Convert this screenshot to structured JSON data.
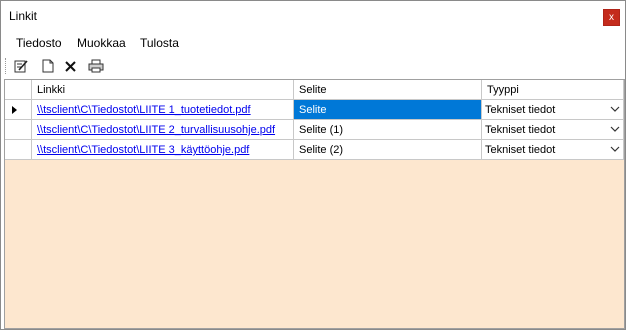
{
  "window": {
    "title": "Linkit",
    "close_label": "x"
  },
  "menu": {
    "items": [
      "Tiedosto",
      "Muokkaa",
      "Tulosta"
    ]
  },
  "toolbar": {
    "icons": [
      "edit-icon",
      "new-document-icon",
      "delete-icon",
      "print-icon"
    ]
  },
  "grid": {
    "headers": [
      "Linkki",
      "Selite",
      "Tyyppi"
    ],
    "rows": [
      {
        "link": "\\\\tsclient\\C\\Tiedostot\\LIITE 1_tuotetiedot.pdf",
        "desc": "Selite",
        "type": "Tekniset tiedot",
        "current": true
      },
      {
        "link": "\\\\tsclient\\C\\Tiedostot\\LIITE 2_turvallisuusohje.pdf",
        "desc": "Selite (1)",
        "type": "Tekniset tiedot",
        "current": false
      },
      {
        "link": "\\\\tsclient\\C\\Tiedostot\\LIITE 3_käyttöohje.pdf",
        "desc": "Selite (2)",
        "type": "Tekniset tiedot",
        "current": false
      }
    ]
  },
  "colors": {
    "grid_background": "#fde7cf",
    "selection": "#0078d7",
    "close_button": "#c42b1c",
    "link": "#0000ee"
  }
}
